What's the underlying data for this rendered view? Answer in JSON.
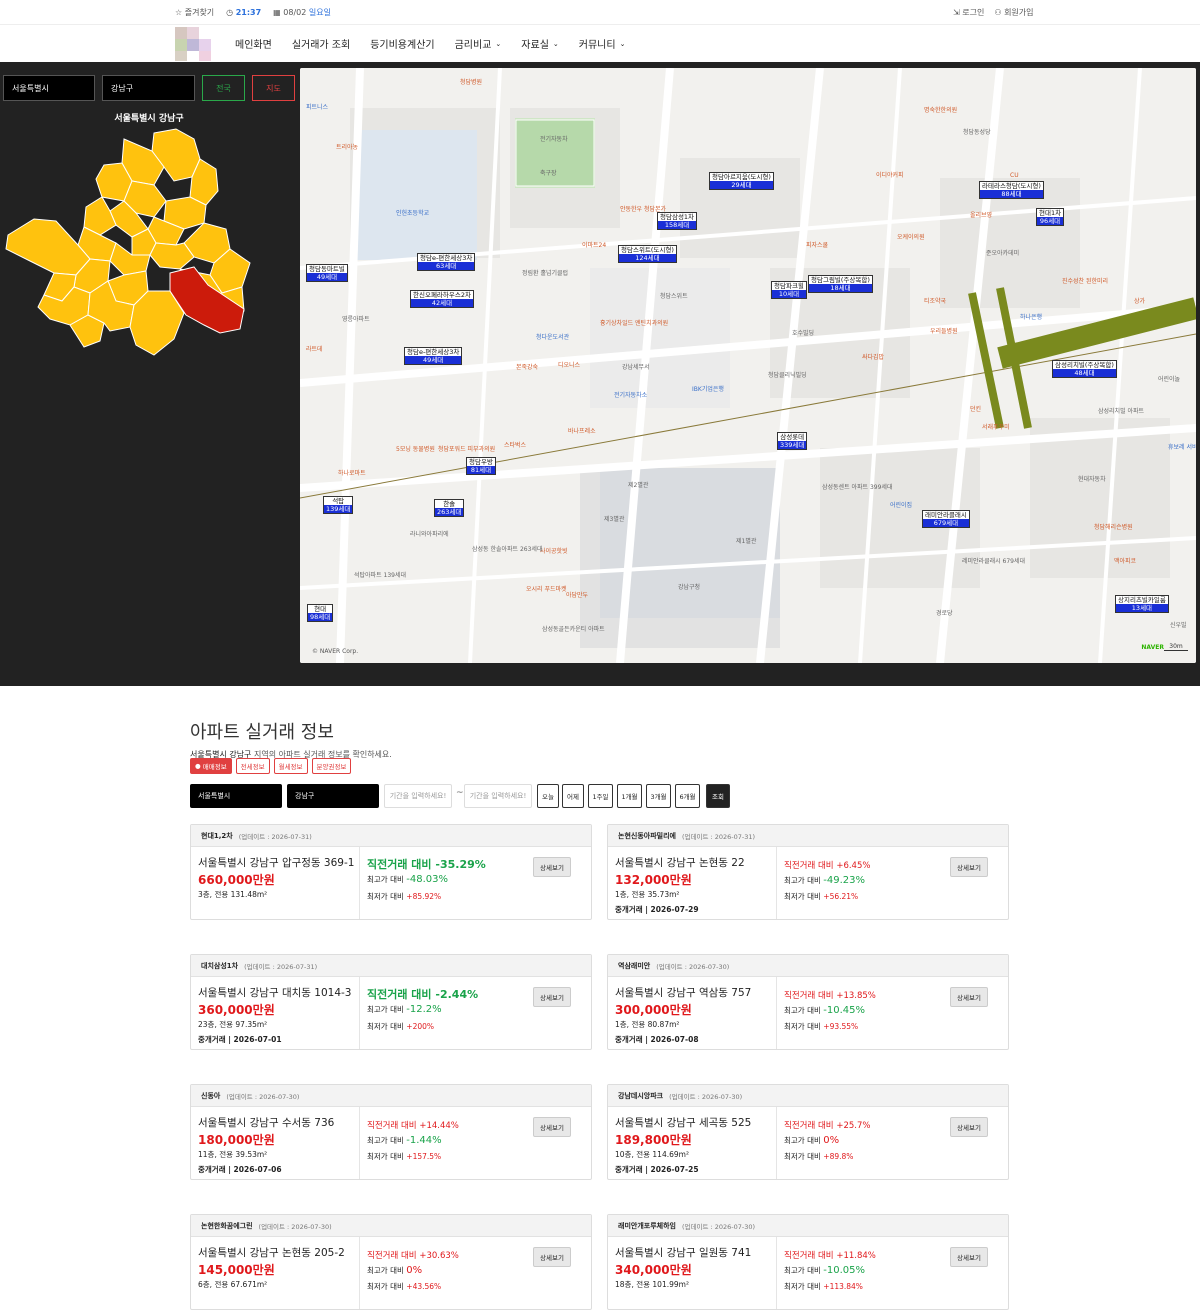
{
  "topbar": {
    "bookmark": "즐겨찾기",
    "time": "21:37",
    "date": "08/02",
    "weekday": "일요일",
    "login": "로그인",
    "signup": "회원가입"
  },
  "nav": {
    "items": [
      "메인화면",
      "실거래가 조회",
      "등기비용계산기",
      "금리비교",
      "자료실",
      "커뮤니티"
    ]
  },
  "map_panel": {
    "city": "서울특별시",
    "district": "강남구",
    "btn_country": "전국",
    "btn_map": "지도",
    "region_title": "서울특별시 강남구",
    "credit": "© NAVER Corp.",
    "naver": "NAVER",
    "scale": "30m",
    "apartments": [
      {
        "name": "청담e-편한세상3차",
        "count": "63세대"
      },
      {
        "name": "한신오페라하우스2차",
        "count": "42세대"
      },
      {
        "name": "청담e-편한세상3차",
        "count": "49세대"
      },
      {
        "name": "청담아르지움(도시형)",
        "count": "29세대"
      },
      {
        "name": "청담삼성1차",
        "count": "158세대"
      },
      {
        "name": "청담스위트(도시형)",
        "count": "124세대"
      },
      {
        "name": "청담그림빌(주상복합)",
        "count": "18세대"
      },
      {
        "name": "청담파크힐",
        "count": "10세대"
      },
      {
        "name": "라테라스청담(도시형)",
        "count": "88세대"
      },
      {
        "name": "현대1차",
        "count": "96세대"
      },
      {
        "name": "삼성리치빌(주상복합)",
        "count": "48세대"
      },
      {
        "name": "삼성롯데",
        "count": "339세대"
      },
      {
        "name": "래미안라클래시",
        "count": "679세대"
      },
      {
        "name": "청담우방",
        "count": "81세대"
      },
      {
        "name": "석탑",
        "count": "139세대"
      },
      {
        "name": "한솔",
        "count": "263세대"
      },
      {
        "name": "현대",
        "count": "98세대"
      },
      {
        "name": "상지리츠빌카일룸",
        "count": "13세대"
      },
      {
        "name": "청담동마트빌",
        "count": "49세대"
      }
    ],
    "pois": [
      "청담병원",
      "피트니스",
      "트리아농",
      "인헌초등학교",
      "전기자동차",
      "축구장",
      "안동한우 청담본가",
      "이마트24",
      "청담스위트",
      "정림환 홀넘기클럽",
      "피자스쿨",
      "오케이의원",
      "이디야커피",
      "명숙한한의원",
      "청담동성당",
      "CU",
      "올리브영",
      "준오아카데미",
      "하나은행",
      "진수성찬 된한미리",
      "상가",
      "티조약국",
      "우리들병원",
      "싸다김밥",
      "호수빌딩",
      "청담클리닉빌딩",
      "IBK기업은행",
      "전기자동차소",
      "강남세무서",
      "청다운도서관",
      "본죽강숙",
      "디오니스",
      "흉기상차일드 엔틴치과의원",
      "영릉아파트",
      "라트데",
      "바나프레소",
      "스타벅스",
      "청담포워드 피부과의원",
      "5모닝 동물병원",
      "하나로마트",
      "삼성동센트 아파트 399세대",
      "어린이집",
      "제2별관",
      "제3별관",
      "제1별관",
      "강남구청",
      "사이공핫빗",
      "오시리 푸드마켓",
      "아담만두",
      "삼성동골든카운티 아파트",
      "라니와아파리에",
      "석탑아파트 139세대",
      "삼성동 한솔아파트 263세대",
      "레미안라클래시 679세대",
      "청담해리슨병원",
      "현대자동차",
      "경로당",
      "던킨",
      "서래푸꾸미",
      "삼성리치빌 아파트",
      "어린이놀",
      "맥아피코",
      "휴보레 서비스센터",
      "신우빌"
    ]
  },
  "section": {
    "title": "아파트 실거래 정보",
    "subtitle_region": "서울특별시 강남구",
    "subtitle_rest": " 지역의 아파트 실거래 정보를 확인하세요.",
    "tabs": [
      "매매정보",
      "전세정보",
      "월세정보",
      "분양권정보"
    ],
    "filter_city": "서울특별시",
    "filter_district": "강남구",
    "date_placeholder": "기간을 입력하세요!",
    "tilde": "~",
    "periods": [
      "오늘",
      "어제",
      "1주일",
      "1개월",
      "3개월",
      "6개월"
    ],
    "search": "조회",
    "detail": "상세보기",
    "label_prev": "직전거래 대비",
    "label_max": "최고가 대비",
    "label_min": "최저가 대비"
  },
  "cards": [
    {
      "name": "현대1,2차",
      "updated": "(업데이트 : 2026-07-31)",
      "addr": "서울특별시 강남구 압구정동 369-1",
      "price": "660,000만원",
      "spec": "3층, 전용 131.48m²",
      "deal": "",
      "prev": "-35.29%",
      "max": "-48.03%",
      "min": "+85.92%"
    },
    {
      "name": "논현신동아파밀리에",
      "updated": "(업데이트 : 2026-07-31)",
      "addr": "서울특별시 강남구 논현동 22",
      "price": "132,000만원",
      "spec": "1층, 전용 35.73m²",
      "deal": "중개거래 | 2026-07-29",
      "prev": "+6.45%",
      "max": "-49.23%",
      "min": "+56.21%"
    },
    {
      "name": "대치삼성1차",
      "updated": "(업데이트 : 2026-07-31)",
      "addr": "서울특별시 강남구 대치동 1014-3",
      "price": "360,000만원",
      "spec": "23층, 전용 97.35m²",
      "deal": "중개거래 | 2026-07-01",
      "prev": "-2.44%",
      "max": "-12.2%",
      "min": "+200%"
    },
    {
      "name": "역삼래미안",
      "updated": "(업데이트 : 2026-07-30)",
      "addr": "서울특별시 강남구 역삼동 757",
      "price": "300,000만원",
      "spec": "1층, 전용 80.87m²",
      "deal": "중개거래 | 2026-07-08",
      "prev": "+13.85%",
      "max": "-10.45%",
      "min": "+93.55%"
    },
    {
      "name": "신동아",
      "updated": "(업데이트 : 2026-07-30)",
      "addr": "서울특별시 강남구 수서동 736",
      "price": "180,000만원",
      "spec": "11층, 전용 39.53m²",
      "deal": "중개거래 | 2026-07-06",
      "prev": "+14.44%",
      "max": "-1.44%",
      "min": "+157.5%"
    },
    {
      "name": "강남데시앙파크",
      "updated": "(업데이트 : 2026-07-30)",
      "addr": "서울특별시 강남구 세곡동 525",
      "price": "189,800만원",
      "spec": "10층, 전용 114.69m²",
      "deal": "중개거래 | 2026-07-25",
      "prev": "+25.7%",
      "max": "0%",
      "min": "+89.8%"
    },
    {
      "name": "논현한화꿈에그린",
      "updated": "(업데이트 : 2026-07-30)",
      "addr": "서울특별시 강남구 논현동 205-2",
      "price": "145,000만원",
      "spec": "6층, 전용 67.671m²",
      "deal": "",
      "prev": "+30.63%",
      "max": "0%",
      "min": "+43.56%"
    },
    {
      "name": "래미안개포루체하임",
      "updated": "(업데이트 : 2026-07-30)",
      "addr": "서울특별시 강남구 일원동 741",
      "price": "340,000만원",
      "spec": "18층, 전용 101.99m²",
      "deal": "",
      "prev": "+11.84%",
      "max": "-10.05%",
      "min": "+113.84%"
    }
  ],
  "colors": {
    "accent_red": "#e0181b",
    "accent_green": "#1aa34a",
    "map_fill": "#ffc20e",
    "selected_district": "#cc1b0b",
    "apt_count_bg": "#1a2fd6"
  }
}
